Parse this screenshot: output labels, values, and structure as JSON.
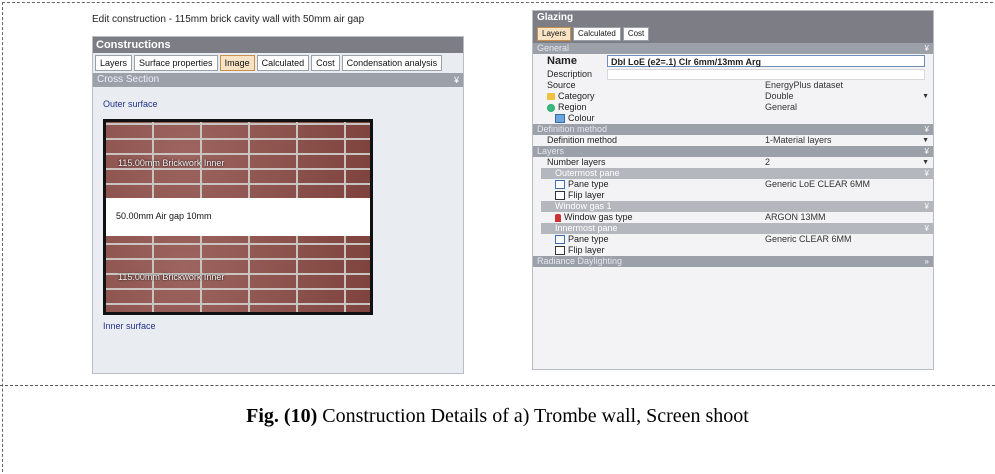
{
  "left_panel": {
    "title": "Edit construction - 115mm brick cavity wall with 50mm air gap",
    "header": "Constructions",
    "tabs": [
      "Layers",
      "Surface properties",
      "Image",
      "Calculated",
      "Cost",
      "Condensation analysis"
    ],
    "active_tab": "Image",
    "section": "Cross Section",
    "outer_surface": "Outer surface",
    "inner_surface": "Inner surface",
    "layers": [
      {
        "label": "115.00mm  Brickwork Inner"
      },
      {
        "label": "50.00mm   Air gap 10mm"
      },
      {
        "label": "115.00mm  Brickwork Inner"
      }
    ]
  },
  "right_panel": {
    "header": "Glazing",
    "tabs": [
      "Layers",
      "Calculated",
      "Cost"
    ],
    "active_tab": "Layers",
    "sections": {
      "general": "General",
      "definition_method": "Definition method",
      "layers": "Layers",
      "radiance": "Radiance Daylighting"
    },
    "general": {
      "name_label": "Name",
      "name_value": "Dbl LoE (e2=.1) Clr 6mm/13mm Arg",
      "description_label": "Description",
      "source_label": "Source",
      "source_value": "EnergyPlus dataset",
      "category_label": "Category",
      "category_value": "Double",
      "region_label": "Region",
      "region_value": "General",
      "colour_label": "Colour"
    },
    "definition": {
      "label": "Definition method",
      "value": "1-Material layers"
    },
    "layers": {
      "number_label": "Number layers",
      "number_value": "2",
      "outermost": "Outermost pane",
      "window_gas": "Window gas 1",
      "innermost": "Innermost pane",
      "pane_type_label": "Pane type",
      "flip_label": "Flip layer",
      "gas_type_label": "Window gas type",
      "outer_pane_value": "Generic LoE CLEAR 6MM",
      "gas_value": "ARGON 13MM",
      "inner_pane_value": "Generic CLEAR 6MM"
    }
  },
  "caption": {
    "fig": "Fig. (10)",
    "text": " Construction Details of a) Trombe wall, Screen shoot"
  }
}
